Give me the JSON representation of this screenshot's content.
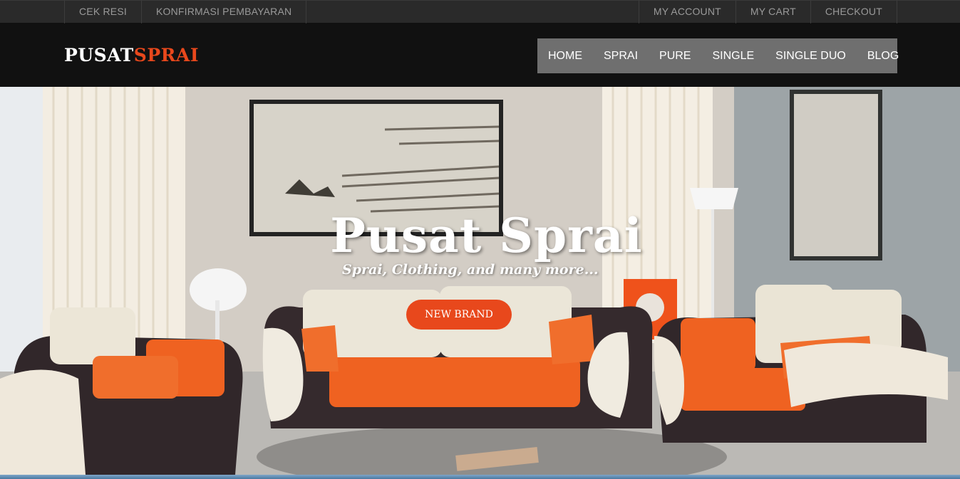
{
  "topbar": {
    "left_links": [
      "CEK RESI",
      "KONFIRMASI PEMBAYARAN"
    ],
    "right_links": [
      "MY ACCOUNT",
      "MY CART",
      "CHECKOUT"
    ]
  },
  "logo": {
    "part1": "PUSAT",
    "part2": "SPRAI"
  },
  "nav": {
    "items": [
      "HOME",
      "SPRAI",
      "PURE",
      "SINGLE",
      "SINGLE DUO",
      "BLOG"
    ]
  },
  "hero": {
    "title": "Pusat Sprai",
    "subtitle": "Sprai, Clothing, and many more...",
    "button_label": "NEW BRAND"
  },
  "colors": {
    "accent": "#e8481c",
    "nav_bg": "#6f6f6f",
    "header_bg": "#111111"
  }
}
